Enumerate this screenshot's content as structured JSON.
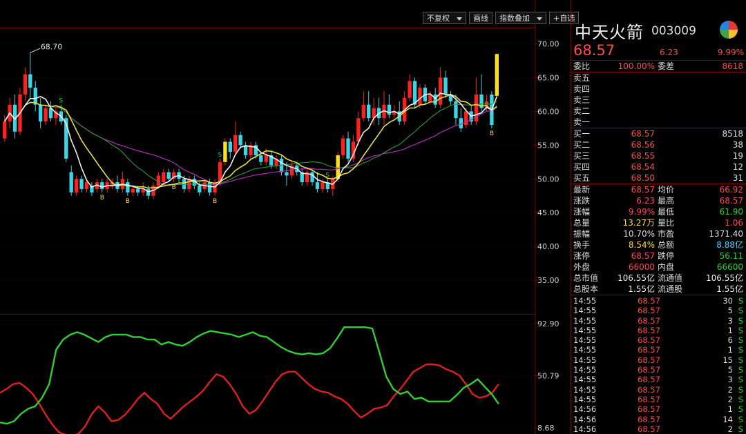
{
  "toolbar": {
    "fq_label": "不复权",
    "draw_label": "画线",
    "index_label": "指数叠加",
    "fav_label": "+自选"
  },
  "stock": {
    "name": "中天火箭",
    "code": "003009",
    "price": "68.57",
    "change": "6.23",
    "change_pct": "9.99%"
  },
  "committee": {
    "ratio_label": "委比",
    "ratio_value": "100.00%",
    "diff_label": "委差",
    "diff_value": "8618"
  },
  "asks": [
    {
      "label": "卖五"
    },
    {
      "label": "卖四"
    },
    {
      "label": "卖三"
    },
    {
      "label": "卖二"
    },
    {
      "label": "卖一"
    }
  ],
  "bids": [
    {
      "label": "买一",
      "price": "68.57",
      "vol": "8518"
    },
    {
      "label": "买二",
      "price": "68.56",
      "vol": "38"
    },
    {
      "label": "买三",
      "price": "68.55",
      "vol": "19"
    },
    {
      "label": "买四",
      "price": "68.54",
      "vol": "12"
    },
    {
      "label": "买五",
      "price": "68.50",
      "vol": "31"
    }
  ],
  "stats": [
    {
      "l1": "最新",
      "v1": "68.57",
      "l2": "均价",
      "v2": "66.92"
    },
    {
      "l1": "涨跌",
      "v1": "6.23",
      "l2": "最高",
      "v2": "68.57"
    },
    {
      "l1": "涨幅",
      "v1": "9.99%",
      "l2": "最低",
      "v2": "61.90"
    },
    {
      "l1": "总量",
      "v1": "13.27万",
      "l2": "量比",
      "v2": "1.06"
    },
    {
      "l1": "振幅",
      "v1": "10.70%",
      "l2": "市盈",
      "v2": "1371.40"
    },
    {
      "l1": "换手",
      "v1": "8.54%",
      "l2": "总额",
      "v2": "8.88亿"
    },
    {
      "l1": "涨停",
      "v1": "68.57",
      "l2": "跌停",
      "v2": "56.11"
    },
    {
      "l1": "外盘",
      "v1": "66000",
      "l2": "内盘",
      "v2": "66600"
    },
    {
      "l1": "总市值",
      "v1": "106.55亿",
      "l2": "流通值",
      "v2": "106.55亿"
    },
    {
      "l1": "总股本",
      "v1": "1.55亿",
      "l2": "流通股",
      "v2": "1.55亿"
    }
  ],
  "ticks": [
    {
      "time": "14:55",
      "price": "68.57",
      "vol": "30",
      "side": "S"
    },
    {
      "time": "14:55",
      "price": "68.57",
      "vol": "5",
      "side": "S"
    },
    {
      "time": "14:55",
      "price": "68.57",
      "vol": "3",
      "side": "S"
    },
    {
      "time": "14:55",
      "price": "68.57",
      "vol": "1",
      "side": "S"
    },
    {
      "time": "14:55",
      "price": "68.57",
      "vol": "6",
      "side": "S"
    },
    {
      "time": "14:55",
      "price": "68.57",
      "vol": "1",
      "side": "S"
    },
    {
      "time": "14:55",
      "price": "68.57",
      "vol": "15",
      "side": "S"
    },
    {
      "time": "14:55",
      "price": "68.57",
      "vol": "5",
      "side": "S"
    },
    {
      "time": "14:55",
      "price": "68.57",
      "vol": "3",
      "side": "S"
    },
    {
      "time": "14:55",
      "price": "68.57",
      "vol": "2",
      "side": "S"
    },
    {
      "time": "14:55",
      "price": "68.57",
      "vol": "2",
      "side": "S"
    },
    {
      "time": "14:56",
      "price": "68.57",
      "vol": "1",
      "side": "S"
    },
    {
      "time": "14:56",
      "price": "68.57",
      "vol": "14",
      "side": "S"
    },
    {
      "time": "14:56",
      "price": "68.57",
      "vol": "2",
      "side": "S"
    }
  ],
  "colors": {
    "up": "#ff2020",
    "down": "#3ad6e6",
    "limit_up": "#ffe020",
    "ma_white": "#f2f2f2",
    "ma_yellow": "#e8e04a",
    "ma_green": "#2e9a3a",
    "ma_purple": "#b030b8",
    "osc_red": "#e02020",
    "osc_green": "#30d030"
  },
  "chart_data": [
    {
      "type": "candlestick",
      "y_ticks": [
        "70.00",
        "65.00",
        "60.00",
        "55.00",
        "50.00",
        "45.00",
        "40.00",
        "35.00"
      ],
      "ylim": [
        30,
        72
      ],
      "high_marker": "68.70",
      "signal_labels": [
        "S",
        "S",
        "S",
        "B",
        "B",
        "B",
        "B",
        "B"
      ],
      "candles": [
        [
          56,
          58.5,
          55.5,
          59.5
        ],
        [
          58.5,
          61,
          57.5,
          62
        ],
        [
          61,
          57,
          56,
          62.5
        ],
        [
          57,
          62.5,
          56.5,
          63.5
        ],
        [
          62.5,
          65.5,
          61.5,
          66.5
        ],
        [
          65.5,
          63.5,
          62,
          68.7
        ],
        [
          63.5,
          61,
          60,
          64.5
        ],
        [
          61,
          58.5,
          57.5,
          62
        ],
        [
          58.5,
          60.5,
          58,
          61
        ],
        [
          60.5,
          59,
          58.5,
          61.5
        ],
        [
          59,
          60,
          58,
          60.5
        ],
        [
          60,
          58.5,
          58,
          61
        ],
        [
          59,
          53,
          52.5,
          59.5
        ],
        [
          51,
          48,
          47.5,
          52
        ],
        [
          48,
          50,
          47.5,
          50.5
        ],
        [
          50,
          48.5,
          48,
          50.5
        ],
        [
          48.5,
          49.5,
          48,
          50
        ],
        [
          49,
          48,
          47.5,
          49.5
        ],
        [
          48.5,
          49.5,
          48,
          50
        ],
        [
          49.5,
          48.5,
          48,
          50
        ],
        [
          48.5,
          49.5,
          48,
          50
        ],
        [
          49,
          49.5,
          48.5,
          50
        ],
        [
          49.5,
          48.5,
          48,
          50.5
        ],
        [
          48.5,
          50,
          48,
          51
        ],
        [
          49.5,
          48,
          47.5,
          50
        ],
        [
          48,
          48.5,
          47.5,
          49
        ],
        [
          48.5,
          48,
          47.5,
          49
        ],
        [
          48,
          48.5,
          47.5,
          49.5
        ],
        [
          48.5,
          47.5,
          47,
          49
        ],
        [
          47.5,
          49,
          47,
          49.5
        ],
        [
          49,
          50.5,
          48.5,
          51
        ],
        [
          49.5,
          51,
          49,
          51.5
        ],
        [
          51,
          50,
          49.5,
          51.5
        ],
        [
          50,
          51,
          49.5,
          51.5
        ],
        [
          51,
          50,
          49.5,
          51.5
        ],
        [
          50,
          48.5,
          48,
          50.5
        ],
        [
          48.5,
          50,
          48,
          50.5
        ],
        [
          50,
          49,
          48.5,
          50.5
        ],
        [
          49,
          48,
          47.5,
          49.5
        ],
        [
          48.5,
          49.5,
          48,
          50
        ],
        [
          49.5,
          48,
          47.5,
          50
        ],
        [
          48,
          49.5,
          47.5,
          50
        ],
        [
          49.5,
          52.5,
          49,
          53
        ],
        [
          52.5,
          55.5,
          52,
          56
        ],
        [
          55.5,
          54,
          53,
          56
        ],
        [
          54,
          56.5,
          53.5,
          58.5
        ],
        [
          56.5,
          55,
          54.5,
          57
        ],
        [
          55,
          53.5,
          53,
          55.5
        ],
        [
          53.5,
          55,
          53,
          55.5
        ],
        [
          55,
          53.5,
          53,
          55.5
        ],
        [
          53.5,
          52.5,
          52,
          54
        ],
        [
          52.5,
          53.5,
          52,
          54.5
        ],
        [
          53.5,
          52,
          51.5,
          54
        ],
        [
          52,
          53,
          51.5,
          53.5
        ],
        [
          53,
          51,
          50.5,
          53.5
        ],
        [
          51,
          50.5,
          49,
          52.5
        ],
        [
          50.5,
          52,
          50,
          52.5
        ],
        [
          52,
          51,
          50.5,
          52.5
        ],
        [
          51,
          49.5,
          49,
          51.5
        ],
        [
          49.5,
          51,
          49,
          51.5
        ],
        [
          51,
          49.5,
          49,
          51.5
        ],
        [
          49.5,
          48.5,
          48,
          51
        ],
        [
          48.5,
          49.5,
          48,
          50
        ],
        [
          49.5,
          48.5,
          48,
          50
        ],
        [
          48.5,
          50,
          47.5,
          50.5
        ],
        [
          50,
          53.5,
          49.5,
          54
        ],
        [
          53.5,
          56,
          53,
          56.5
        ],
        [
          56,
          53,
          52.5,
          57
        ],
        [
          53,
          55.5,
          52.5,
          56.5
        ],
        [
          55.5,
          59,
          55,
          60
        ],
        [
          59,
          61,
          58.5,
          63
        ],
        [
          61,
          59,
          58.5,
          63
        ],
        [
          59,
          60.5,
          58,
          62
        ],
        [
          60.5,
          59,
          58,
          62
        ],
        [
          59,
          61,
          58,
          63
        ],
        [
          61,
          59.5,
          59,
          62.5
        ],
        [
          59.5,
          60,
          59,
          61
        ],
        [
          60,
          58.5,
          58,
          61.5
        ],
        [
          58.5,
          62,
          58,
          63
        ],
        [
          62,
          64.5,
          61.5,
          65.5
        ],
        [
          64.5,
          61,
          60.5,
          65
        ],
        [
          61,
          63.5,
          60.5,
          64
        ],
        [
          63.5,
          61.5,
          61,
          64
        ],
        [
          61.5,
          62.5,
          61,
          63
        ],
        [
          62.5,
          61,
          60.5,
          63.5
        ],
        [
          61,
          65,
          60.5,
          66.5
        ],
        [
          65,
          62.5,
          62,
          66
        ],
        [
          62.5,
          61.5,
          61,
          63
        ],
        [
          61.5,
          59,
          58,
          62.5
        ],
        [
          59,
          57.5,
          57,
          60.5
        ],
        [
          58,
          60,
          57.5,
          60.5
        ],
        [
          60,
          58.5,
          58,
          61
        ],
        [
          58.5,
          62.5,
          58,
          65
        ],
        [
          62.5,
          60.5,
          60,
          65.5
        ],
        [
          60.5,
          61.5,
          60,
          62.5
        ],
        [
          62.5,
          58,
          57.5,
          63
        ],
        [
          62.3,
          68.5,
          62,
          68.6
        ]
      ]
    },
    {
      "type": "line",
      "y_ticks": [
        "92.90",
        "50.79",
        "8.68"
      ],
      "ylim": [
        8.68,
        92.9
      ],
      "series": [
        {
          "values": [
            37,
            40,
            44,
            45,
            41,
            36,
            28,
            19,
            11,
            5,
            3,
            2,
            4,
            10,
            20,
            26,
            21,
            14,
            15,
            19,
            25,
            32,
            37,
            32,
            28,
            20,
            16,
            21,
            26,
            30,
            34,
            39,
            46,
            52,
            50,
            44,
            36,
            26,
            20,
            23,
            30,
            38,
            46,
            52,
            54,
            54,
            49,
            44,
            40,
            38,
            37,
            34,
            32,
            28,
            22,
            17,
            20,
            24,
            25,
            27,
            34,
            40,
            47,
            54,
            57,
            60,
            60,
            59,
            56,
            54,
            51,
            44,
            36,
            33,
            34,
            37,
            44
          ]
        },
        {
          "values": [
            13,
            12,
            14,
            20,
            24,
            26,
            33,
            44,
            72,
            80,
            84,
            86,
            84,
            81,
            78,
            82,
            84,
            84,
            84,
            82,
            82,
            80,
            80,
            76,
            78,
            76,
            75,
            78,
            82,
            85,
            87,
            86,
            85,
            84,
            82,
            84,
            86,
            83,
            82,
            78,
            74,
            71,
            69,
            68,
            69,
            68,
            69,
            73,
            81,
            90,
            90,
            90,
            90,
            89,
            70,
            50,
            40,
            36,
            38,
            32,
            33,
            30,
            30,
            30,
            30,
            35,
            41,
            44,
            48,
            42,
            36,
            28
          ]
        }
      ]
    }
  ]
}
